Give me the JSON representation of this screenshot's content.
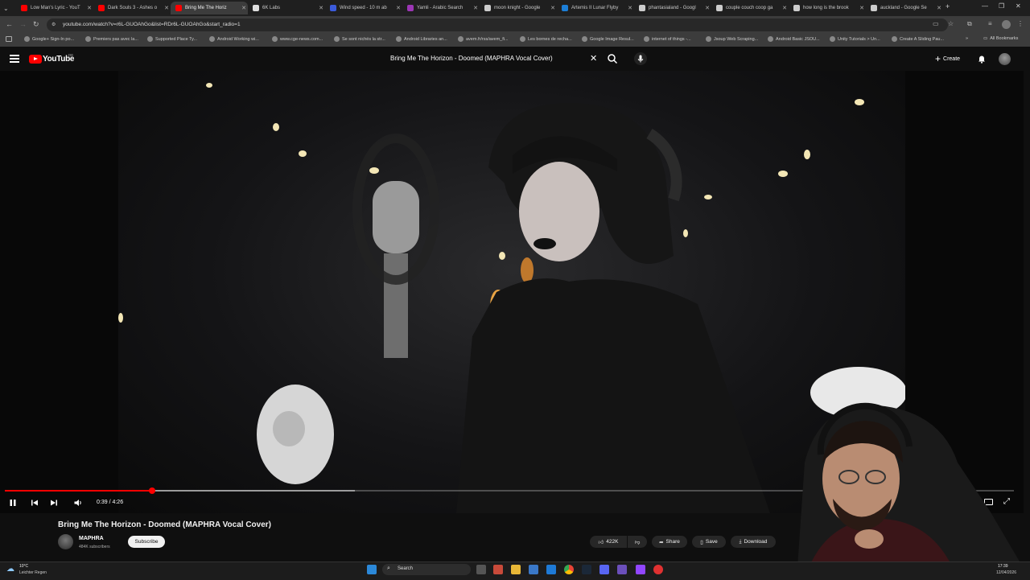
{
  "browser": {
    "tabs": [
      {
        "title": "Low Man's Lyric - YouT",
        "color": "#ff0000"
      },
      {
        "title": "Dark Souls 3 - Ashes o",
        "color": "#ff0000"
      },
      {
        "title": "Bring Me The Horiz",
        "color": "#ff0000",
        "active": true
      },
      {
        "title": "6K Labs",
        "color": "#dddddd"
      },
      {
        "title": "Wind speed - 10 m ab",
        "color": "#3b5bdb"
      },
      {
        "title": "Yamli - Arabic Search",
        "color": "#9c36b5"
      },
      {
        "title": "moon knight - Google",
        "color": "#cccccc"
      },
      {
        "title": "Artemis II Lunar Flyby",
        "color": "#1c7ed6"
      },
      {
        "title": "phantasialand - Googl",
        "color": "#cccccc"
      },
      {
        "title": "couple couch coop ga",
        "color": "#cccccc"
      },
      {
        "title": "how long is the brook",
        "color": "#cccccc"
      },
      {
        "title": "auckland - Google Se",
        "color": "#cccccc"
      }
    ],
    "url": "youtube.com/watch?v=r6L-GUOAhGo&list=RDr6L-GUOAhGo&start_radio=1",
    "bookmarks": [
      "Google+ Sign-In po...",
      "Premiers pas avec la...",
      "Supported Place Ty...",
      "Android Working wi...",
      "www.cge-news.com...",
      "Se sont nichés la str...",
      "Android Libraries an...",
      "avem.fr/rss/avem_fi...",
      "Les bornes de recha...",
      "Google Image Resul...",
      "internet of things -...",
      "Jsoup Web Scraping...",
      "Android Basic JSOU...",
      "Unity Tutorials > Un...",
      "Create A Sliding Pau..."
    ],
    "all_bookmarks": "All Bookmarks"
  },
  "youtube": {
    "logo_text": "YouTube",
    "logo_region": "DE",
    "search_query": "Bring Me The Horizon - Doomed (MAPHRA Vocal Cover)",
    "create_label": "Create"
  },
  "player": {
    "time": "0:39 / 4:26",
    "progress_fraction": 0.146,
    "buffered_fraction": 0.347
  },
  "video_info": {
    "title": "Bring Me The Horizon - Doomed (MAPHRA Vocal Cover)",
    "channel": "MAPHRA",
    "subscribers": "484K subscribers",
    "subscribe_label": "Subscribe",
    "likes": "422K",
    "share_label": "Share",
    "save_label": "Save",
    "download_label": "Download"
  },
  "taskbar": {
    "weather_temp": "10°C",
    "weather_desc": "Leichter Regen",
    "search_label": "Search",
    "time": "17:39",
    "date": "12/04/2026"
  },
  "colors": {
    "brand_red": "#ff0000",
    "background": "#0f0f0f",
    "pill": "#272727"
  }
}
